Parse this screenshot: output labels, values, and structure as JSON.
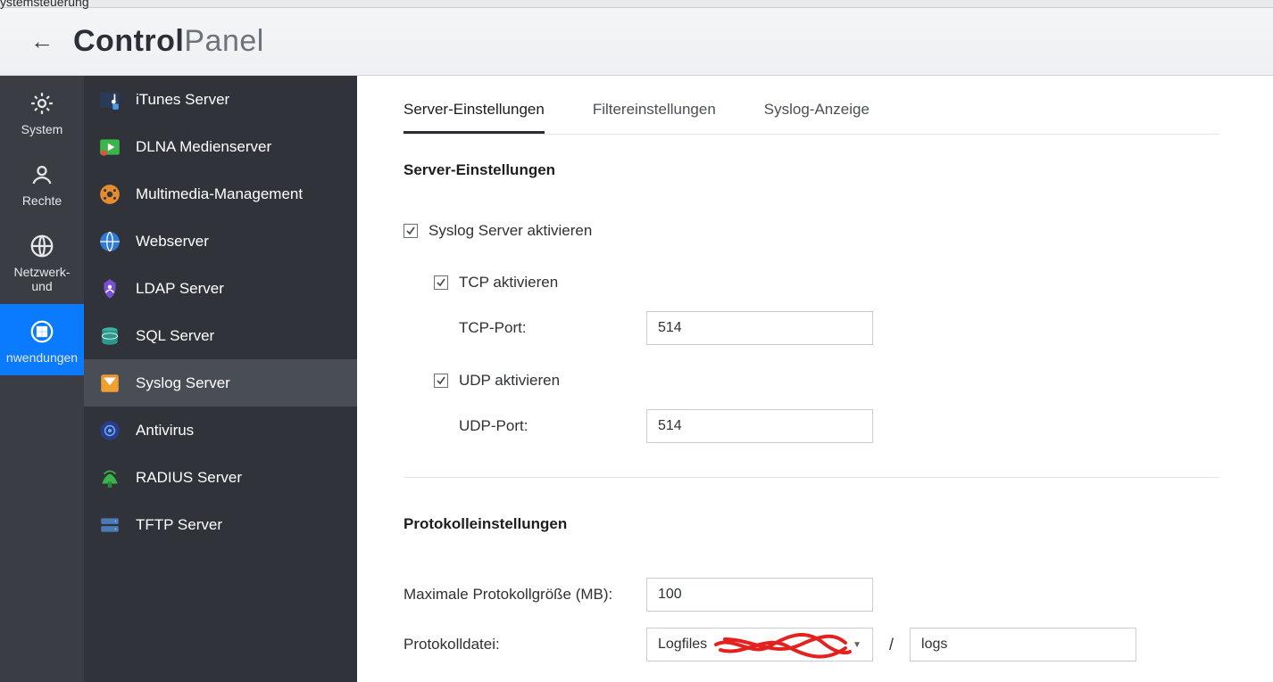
{
  "topstrip_text": "ystemsteuerung",
  "header": {
    "title_strong": "Control",
    "title_light": "Panel"
  },
  "leftnav": [
    {
      "label": "System"
    },
    {
      "label": "Rechte"
    },
    {
      "label": "Netzwerk- und"
    },
    {
      "label": "nwendungen"
    }
  ],
  "midnav": [
    {
      "label": "iTunes Server"
    },
    {
      "label": "DLNA Medienserver"
    },
    {
      "label": "Multimedia-Management"
    },
    {
      "label": "Webserver"
    },
    {
      "label": "LDAP Server"
    },
    {
      "label": "SQL Server"
    },
    {
      "label": "Syslog Server"
    },
    {
      "label": "Antivirus"
    },
    {
      "label": "RADIUS Server"
    },
    {
      "label": "TFTP Server"
    }
  ],
  "tabs": [
    {
      "label": "Server-Einstellungen"
    },
    {
      "label": "Filtereinstellungen"
    },
    {
      "label": "Syslog-Anzeige"
    }
  ],
  "server_section": {
    "heading": "Server-Einstellungen",
    "enable_syslog": "Syslog Server aktivieren",
    "enable_tcp": "TCP aktivieren",
    "tcp_port_label": "TCP-Port:",
    "tcp_port_value": "514",
    "enable_udp": "UDP aktivieren",
    "udp_port_label": "UDP-Port:",
    "udp_port_value": "514"
  },
  "log_section": {
    "heading": "Protokolleinstellungen",
    "max_size_label": "Maximale Protokollgröße (MB):",
    "max_size_value": "100",
    "logfile_label": "Protokolldatei:",
    "logfile_select": "Logfiles",
    "logfile_name": "logs",
    "slash": "/"
  }
}
